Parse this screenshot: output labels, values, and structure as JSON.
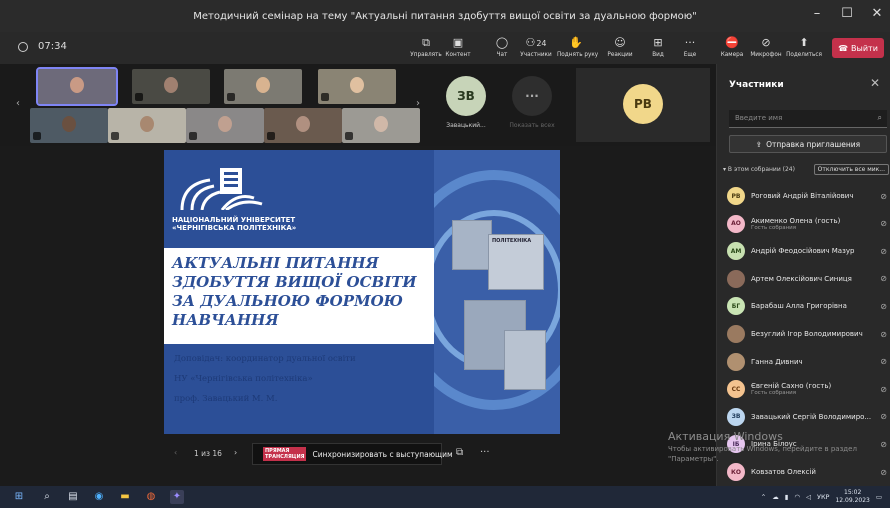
{
  "window": {
    "title": "Методичний семінар на тему \"Актуальні питання здобуття вищої освіти за дуальною формою\"",
    "controls": [
      "–",
      "☐",
      "✕"
    ]
  },
  "toolbar": {
    "timer": "07:34",
    "buttons": [
      {
        "label": "Управлять",
        "icon": "screen-control-icon"
      },
      {
        "label": "Контент",
        "icon": "content-icon"
      },
      {
        "label": "Чат",
        "icon": "chat-icon"
      },
      {
        "label": "Участники",
        "icon": "people-icon",
        "count": "24"
      },
      {
        "label": "Поднять руку",
        "icon": "hand-icon"
      },
      {
        "label": "Реакции",
        "icon": "reaction-icon"
      },
      {
        "label": "Вид",
        "icon": "view-icon"
      },
      {
        "label": "Еще",
        "icon": "more-icon"
      },
      {
        "label": "Камера",
        "icon": "camera-off-icon"
      },
      {
        "label": "Микрофон",
        "icon": "mic-off-icon"
      },
      {
        "label": "Поделиться",
        "icon": "share-icon"
      }
    ],
    "leave_label": "Выйти"
  },
  "strip": {
    "tiles": [
      {
        "initials": "ЗВ",
        "name": "Завацький...",
        "color": "#c7d4b8",
        "text_color": "#2a3a20"
      },
      {
        "initials": "···",
        "name": "Показать всех",
        "color": "#2e2e2e",
        "text_color": "#aaaaaa"
      },
      {
        "initials": "PB",
        "name": "",
        "color": "#f1d78a",
        "text_color": "#4a3a10"
      }
    ]
  },
  "slide": {
    "logo_lines": [
      "НАЦІОНАЛЬНИЙ УНІВЕРСИТЕТ",
      "«ЧЕРНІГІВСЬКА ПОЛІТЕХНІКА»"
    ],
    "title_lines": [
      "АКТУАЛЬНІ ПИТАННЯ",
      "ЗДОБУТТЯ ВИЩОЇ ОСВІТИ",
      "ЗА ДУАЛЬНОЮ ФОРМОЮ",
      "НАВЧАННЯ"
    ],
    "speaker_lines": [
      "Доповідач: координатор дуальної освіти",
      "НУ «Чернігівська політехніка»",
      "проф. Завацький М. М."
    ],
    "photo_sign": "ПОЛІТЕХНІКА"
  },
  "slidebar": {
    "page": "1 из 16",
    "sync_logo": "ПРЯМАЯ ТРАНСЛЯЦИЯ",
    "sync_label": "Синхронизировать с выступающим"
  },
  "panel": {
    "title": "Участники",
    "search_placeholder": "Введите имя",
    "invite_label": "Отправка приглашения",
    "meeting_group": "В этом собрании (24)",
    "mute_all": "Отключить все мик...",
    "participants": [
      {
        "initials": "PB",
        "name": "Роговий Андрій Віталійович",
        "sub": "",
        "color": "#f1d78a",
        "text_color": "#4a3a10"
      },
      {
        "initials": "AO",
        "name": "Акименко Олена (гость)",
        "sub": "Гость собрания",
        "color": "#f3b8c8",
        "text_color": "#6a1f36"
      },
      {
        "initials": "AM",
        "name": "Андрій Феодосійович Мазур",
        "sub": "",
        "color": "#c7e0b0",
        "text_color": "#2a4a18"
      },
      {
        "initials": "",
        "name": "Артем Олексійович Синиця",
        "sub": "",
        "color": "#8a6a5a",
        "text_color": "#ffffff"
      },
      {
        "initials": "БГ",
        "name": "Барабаш Алла Григорівна",
        "sub": "",
        "color": "#c9e4b4",
        "text_color": "#2a4a18"
      },
      {
        "initials": "",
        "name": "Безуглий Ігор Володимирович",
        "sub": "",
        "color": "#9a7a60",
        "text_color": "#ffffff"
      },
      {
        "initials": "",
        "name": "Ганна Дивнич",
        "sub": "",
        "color": "#b09070",
        "text_color": "#ffffff"
      },
      {
        "initials": "CC",
        "name": "Євгеній Сахно (гость)",
        "sub": "Гость собрания",
        "color": "#f4c38f",
        "text_color": "#6a3a10"
      },
      {
        "initials": "ЗВ",
        "name": "Завацький Сергій Володимиро...",
        "sub": "",
        "color": "#bcd6ef",
        "text_color": "#1e3a5a"
      },
      {
        "initials": "IБ",
        "name": "Ірина Білоус",
        "sub": "",
        "color": "#e6c6ef",
        "text_color": "#4a2a5a"
      },
      {
        "initials": "КО",
        "name": "Ковзатов Олексій",
        "sub": "",
        "color": "#f3b8c8",
        "text_color": "#6a1f36"
      }
    ]
  },
  "watermark": {
    "line1": "Активация Windows",
    "line2": "Чтобы активировать Windows, перейдите в раздел",
    "line3": "\"Параметры\"."
  },
  "taskbar": {
    "lang": "УКР",
    "time": "15:02",
    "date": "12.09.2023"
  },
  "colors": {
    "accent": "#7f85f5",
    "leave": "#c4314b",
    "slide_blue": "#2c4f97"
  }
}
